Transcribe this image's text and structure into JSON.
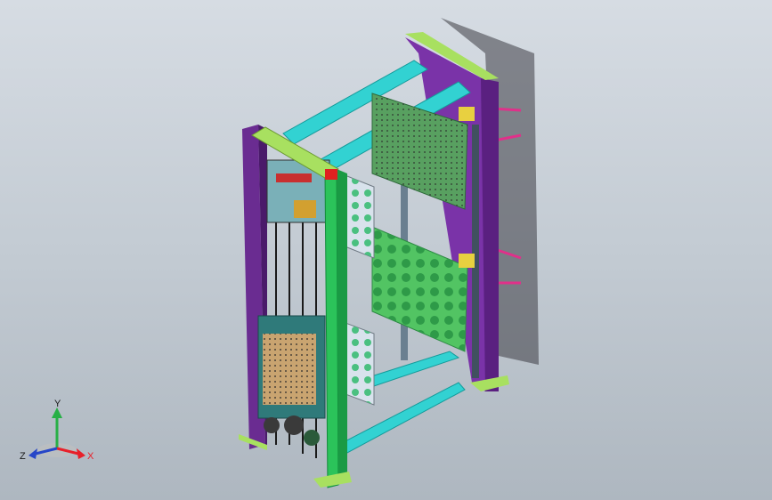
{
  "viewport": {
    "background_top": "#d6dce3",
    "background_bottom": "#aeb7c0"
  },
  "triad": {
    "x_label": "X",
    "y_label": "Y",
    "z_label": "Z",
    "x_color": "#e8202a",
    "y_color": "#28b046",
    "z_color": "#2646c8"
  },
  "model_colors": {
    "upright_violet": "#6a2c91",
    "upright_green": "#2bc35a",
    "crossbar_cyan": "#32d2d2",
    "top_cap": "#a8e060",
    "shelf_green": "#52c463",
    "shelf_dots": "#2e9a48",
    "rod_magenta": "#e0308a",
    "mesh_box": "#c9a470",
    "shadow": "#3c3c44"
  }
}
